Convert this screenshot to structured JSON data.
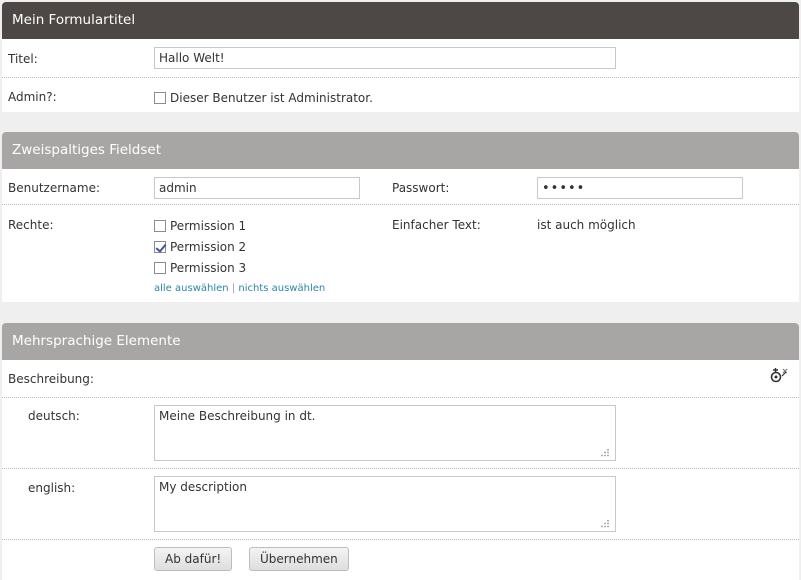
{
  "panel1": {
    "title": "Mein Formulartitel",
    "title_label": "Titel:",
    "title_value": "Hallo Welt!",
    "admin_label": "Admin?:",
    "admin_checkbox_label": "Dieser Benutzer ist Administrator.",
    "admin_checked": false
  },
  "panel2": {
    "title": "Zweispaltiges Fieldset",
    "username_label": "Benutzername:",
    "username_value": "admin",
    "password_label": "Passwort:",
    "password_value": "•••••",
    "rights_label": "Rechte:",
    "permissions": [
      {
        "label": "Permission 1",
        "checked": false
      },
      {
        "label": "Permission 2",
        "checked": true
      },
      {
        "label": "Permission 3",
        "checked": false
      }
    ],
    "select_all": "alle auswählen",
    "separator": "|",
    "select_none": "nichts auswählen",
    "plain_text_label": "Einfacher Text:",
    "plain_text_value": "ist auch möglich"
  },
  "panel3": {
    "title": "Mehrsprachige Elemente",
    "description_label": "Beschreibung:",
    "lang_icon": "language-toggle-icon",
    "languages": [
      {
        "label": "deutsch:",
        "value": "Meine Beschreibung in dt."
      },
      {
        "label": "english:",
        "value": "My description"
      }
    ],
    "submit_button": "Ab dafür!",
    "apply_button": "Übernehmen"
  }
}
